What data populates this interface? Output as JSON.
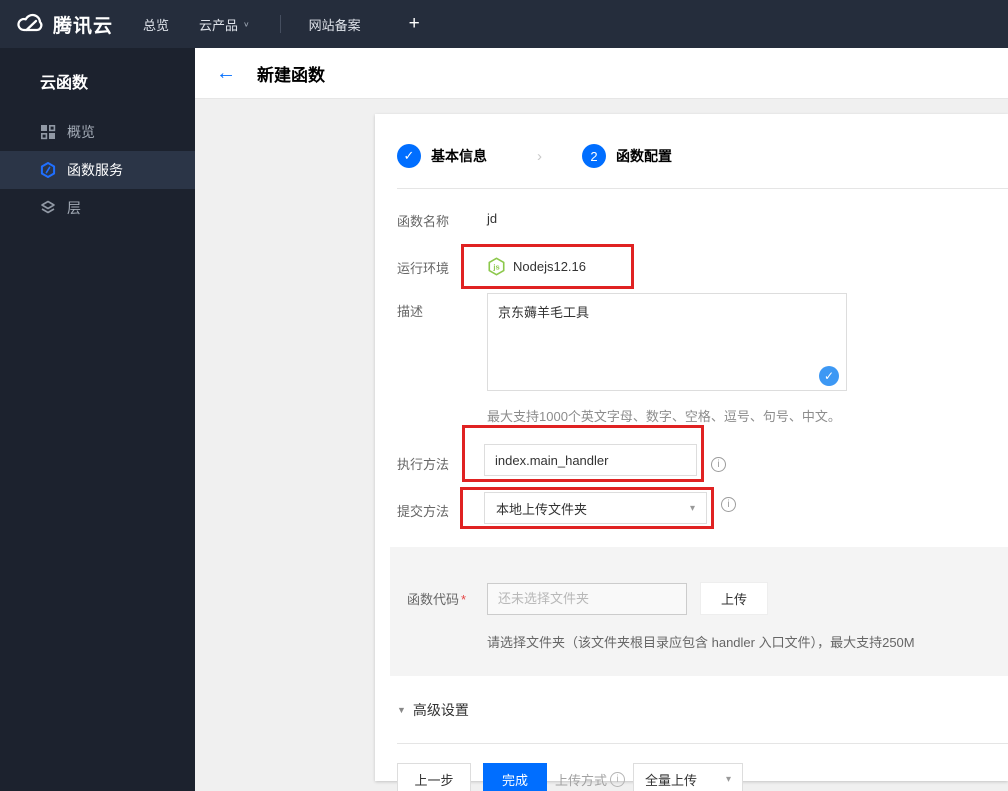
{
  "navbar": {
    "brand": "腾讯云",
    "items": [
      {
        "label": "总览"
      },
      {
        "label": "云产品"
      },
      {
        "label": "网站备案"
      }
    ],
    "plus": "+"
  },
  "sidebar": {
    "title": "云函数",
    "items": [
      {
        "label": "概览",
        "icon": "grid-icon",
        "active": false
      },
      {
        "label": "函数服务",
        "icon": "scf-hexagon-icon",
        "active": true
      },
      {
        "label": "层",
        "icon": "layers-icon",
        "active": false
      }
    ]
  },
  "header": {
    "title": "新建函数"
  },
  "steps": [
    {
      "num": "1",
      "label": "基本信息",
      "state": "done"
    },
    {
      "num": "2",
      "label": "函数配置",
      "state": "current"
    }
  ],
  "form": {
    "function_name": {
      "label": "函数名称",
      "value": "jd"
    },
    "runtime": {
      "label": "运行环境",
      "value": "Nodejs12.16",
      "icon": "nodejs-icon"
    },
    "description": {
      "label": "描述",
      "value": "京东薅羊毛工具",
      "hint": "最大支持1000个英文字母、数字、空格、逗号、句号、中文。"
    },
    "handler": {
      "label": "执行方法",
      "value": "index.main_handler"
    },
    "submit_method": {
      "label": "提交方法",
      "value": "本地上传文件夹"
    },
    "function_code": {
      "label": "函数代码",
      "required_mark": "*",
      "placeholder": "还未选择文件夹",
      "upload_button": "上传",
      "hint": "请选择文件夹（该文件夹根目录应包含 handler 入口文件），最大支持250M"
    },
    "advanced": {
      "label": "高级设置"
    }
  },
  "footer": {
    "prev_button": "上一步",
    "finish_button": "完成",
    "upload_mode_label": "上传方式",
    "upload_mode_value": "全量上传"
  },
  "icons": {
    "back": "←",
    "check": "✓",
    "caret_down": "▾",
    "nav_caret": "∨",
    "triangle_down": "▼",
    "info": "i",
    "step_separator": "›"
  },
  "colors": {
    "accent_blue": "#006eff",
    "highlight_red": "#e02222",
    "node_green": "#8cc84b",
    "badge_blue": "#3d98f4",
    "navbar_bg": "#252d3c",
    "sidebar_bg": "#1c222e",
    "sidebar_active_bg": "#2b3547"
  }
}
